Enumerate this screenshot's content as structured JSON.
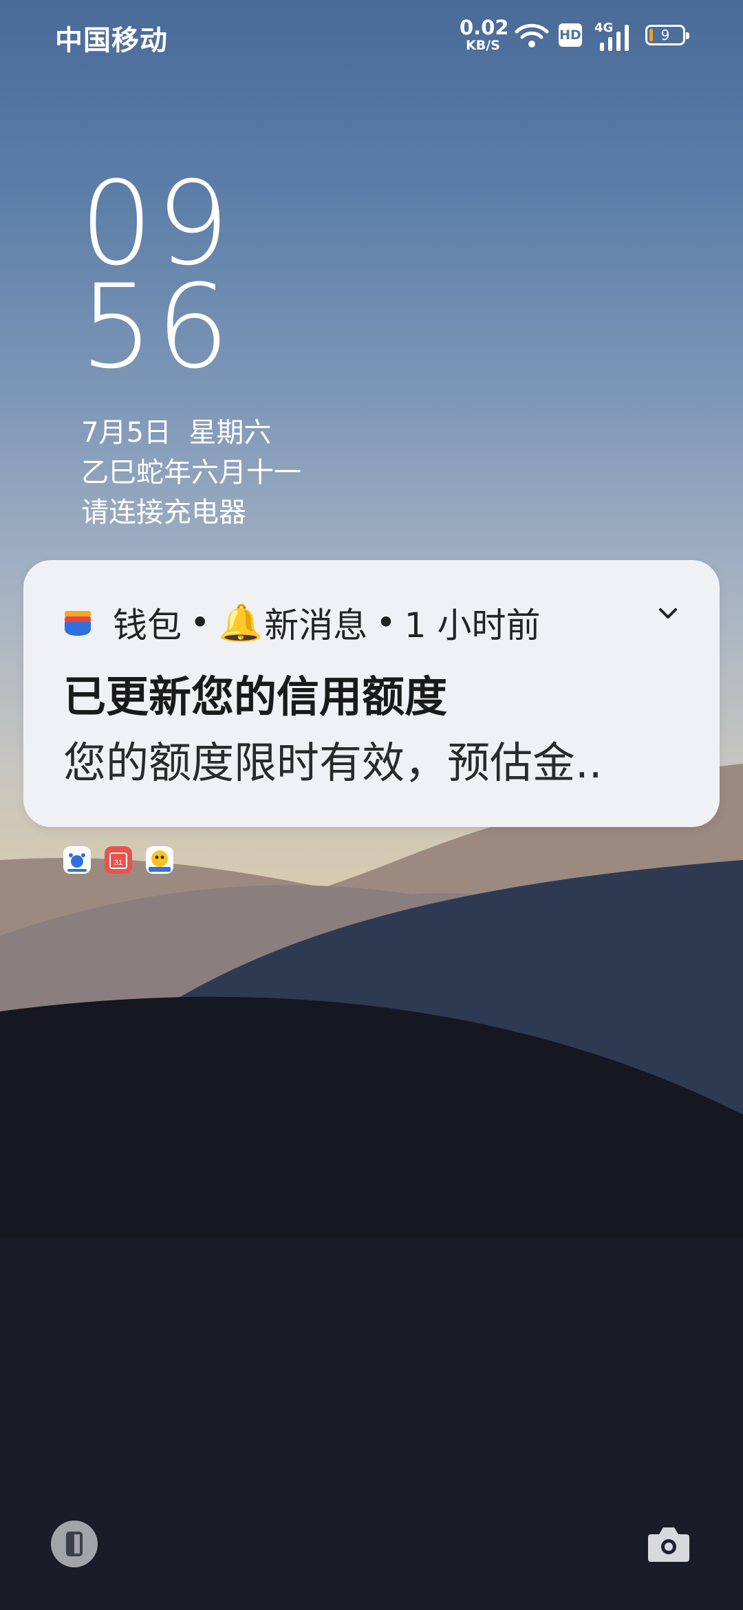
{
  "status_bar": {
    "carrier": "中国移动",
    "net_speed_value": "0.02",
    "net_speed_unit": "KB/S",
    "hd_label": "HD",
    "network_type": "4G",
    "battery_level": "9",
    "icons": [
      "wifi-icon",
      "hd-icon",
      "signal-icon",
      "battery-icon"
    ]
  },
  "lockscreen": {
    "hour": "09",
    "minute": "56",
    "date": "7月5日  星期六",
    "lunar_date": "乙巳蛇年六月十一",
    "charging_hint": "请连接充电器"
  },
  "notification": {
    "app_name": "钱包",
    "separator": "•",
    "category_emoji": "🔔",
    "category": "新消息",
    "time": "1 小时前",
    "title": "已更新您的信用额度",
    "body": "您的额度限时有效，预估金..",
    "icons": [
      "wallet-icon",
      "bell-icon",
      "chevron-down-icon"
    ]
  },
  "notification_app_icons": [
    "baidu-icon",
    "calendar-icon",
    "video-app-icon"
  ],
  "calendar_icon_day": "31",
  "bottom": {
    "left_shortcut_icon": "phone-icon",
    "right_shortcut_icon": "camera-icon"
  },
  "colors": {
    "card_background": "#f0f1f5",
    "battery_fill": "#f0a020",
    "sky_top": "#4a6a98"
  }
}
